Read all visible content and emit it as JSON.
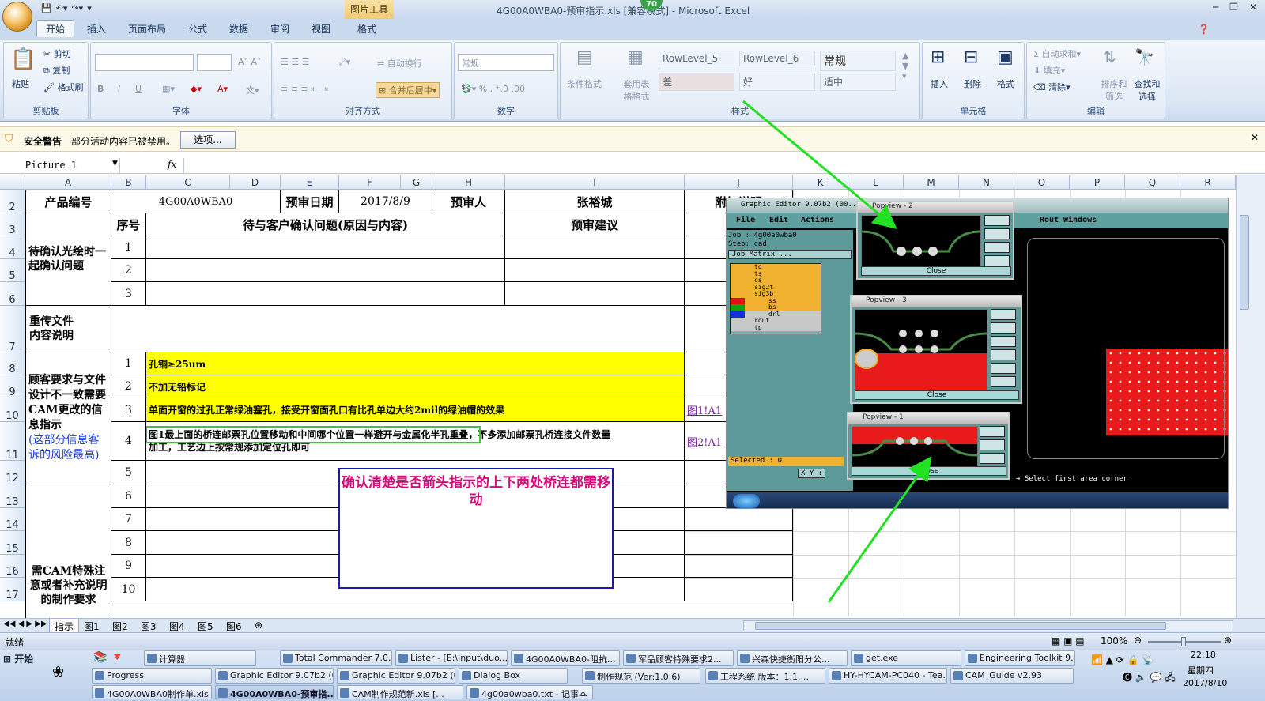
{
  "window": {
    "title": "4G00A0WBA0-预审指示.xls  [兼容模式] - Microsoft Excel",
    "contextual_tab": "图片工具",
    "badge": "70"
  },
  "tabs": [
    "开始",
    "插入",
    "页面布局",
    "公式",
    "数据",
    "审阅",
    "视图",
    "格式"
  ],
  "ribbon": {
    "clipboard": {
      "paste": "粘贴",
      "cut": "剪切",
      "copy": "复制",
      "format_painter": "格式刷",
      "label": "剪贴板"
    },
    "font": {
      "label": "字体"
    },
    "alignment": {
      "wrap": "自动换行",
      "merge": "合并后居中",
      "label": "对齐方式"
    },
    "number": {
      "format": "常规",
      "label": "数字"
    },
    "styles": {
      "conditional": "条件格式",
      "table_format": "套用表格格式",
      "items": [
        "RowLevel_5",
        "RowLevel_6",
        "常规",
        "差",
        "好",
        "适中"
      ],
      "label": "样式"
    },
    "cells": {
      "insert": "插入",
      "delete": "删除",
      "format": "格式",
      "label": "单元格"
    },
    "editing": {
      "autosum": "自动求和",
      "fill": "填充",
      "clear": "清除",
      "sort": "排序和筛选",
      "find": "查找和选择",
      "label": "编辑"
    }
  },
  "security": {
    "title": "安全警告",
    "message": "部分活动内容已被禁用。",
    "button": "选项..."
  },
  "formula_bar": {
    "name_box": "Picture 1",
    "fx": "fx",
    "value": ""
  },
  "columns": [
    "A",
    "B",
    "C",
    "D",
    "E",
    "F",
    "G",
    "H",
    "I",
    "J",
    "K",
    "L",
    "M",
    "N",
    "O",
    "P",
    "Q",
    "R"
  ],
  "rows": [
    "2",
    "3",
    "4",
    "5",
    "6",
    "7",
    "8",
    "9",
    "10",
    "11",
    "12",
    "13",
    "14",
    "15",
    "16",
    "17"
  ],
  "sheet": {
    "product_label": "产品编号",
    "product_no": "4G00A0WBA0",
    "date_label": "预审日期",
    "date": "2017/8/9",
    "reviewer_label": "预审人",
    "reviewer": "张裕城",
    "attach_label": "附加说明",
    "seq_label": "序号",
    "question_label": "待与客户确认问题(原因与内容)",
    "suggest_label": "预审建议",
    "sec1": "待确认光绘时一起确认问题",
    "sec2": "重传文件\n内容说明",
    "sec3": "顾客要求与文件设计不一致需要CAM更改的信息指示",
    "sec3_note": "(这部分信息客诉的风险最高)",
    "sec4": "需CAM特殊注意或者补充说明的制作要求",
    "n1": "1",
    "n2": "2",
    "n3": "3",
    "n4": "4",
    "n5": "5",
    "n6": "6",
    "n7": "7",
    "n8": "8",
    "n9": "9",
    "n10": "10",
    "req1": "孔铜≥25um",
    "req2": "不加无铅标记",
    "req3": "单面开窗的过孔正常绿油塞孔，接受开窗面孔口有比孔单边大约2mil的绿油帽的效果",
    "req4a": "图1最上面的桥连邮票孔位置移动和中间哪个位置一样避开与金属化半孔重叠，",
    "req4b": "不多添加邮票孔桥连接文件数量",
    "req4c": "加工，工艺边上按常规添加定位孔即可",
    "link3": "图1!A1",
    "link4": "图2!A1"
  },
  "note": "确认清楚是否箭头指示的上下两处桥连都需移动",
  "graphic_editor": {
    "title": "Graphic Editor 9.07b2 (00...",
    "menu": [
      "File",
      "Edit",
      "Actions",
      "Rout",
      "Windows"
    ],
    "job": "Job  : 4g00a0wba0",
    "step": "Step: cad",
    "matrix": "Job Matrix ...",
    "layers": [
      "to",
      "ts",
      "cs",
      "sig2t",
      "sig3b",
      "ss",
      "bs",
      "drl",
      "rout",
      "tp"
    ],
    "selected": "Selected : 0",
    "xy": "X Y :",
    "prompt": "Select first area corner",
    "popviews": [
      "Popview - 2",
      "Popview - 3",
      "Popview - 1"
    ],
    "close": "Close"
  },
  "sheet_tabs": [
    "指示",
    "图1",
    "图2",
    "图3",
    "图4",
    "图5",
    "图6"
  ],
  "status": {
    "ready": "就绪",
    "zoom": "100%"
  },
  "taskbar": {
    "start": "开始",
    "row1": [
      "计算器",
      "Total Commander 7.0...",
      "Lister - [E:\\input\\duo...",
      "4G00A0WBA0-阻抗...",
      "军品顾客特殊要求2...",
      "兴森快捷衡阳分公...",
      "get.exe",
      "Engineering Toolkit 9...."
    ],
    "row2": [
      "Progress",
      "Graphic Editor 9.07b2 (0...",
      "Graphic Editor 9.07b2 (0...",
      "Dialog Box",
      "制作规范 (Ver:1.0.6)",
      "工程系统  版本：1.1....",
      "HY-HYCAM-PC040 - Tea...",
      "CAM_Guide v2.93"
    ],
    "row3": [
      "4G00A0WBA0制作单.xls",
      "4G00A0WBA0-预审指...",
      "CAM制作规范新.xls [...",
      "4g00a0wba0.txt - 记事本"
    ],
    "time": "22:18",
    "weekday": "星期四",
    "date": "2017/8/10"
  }
}
